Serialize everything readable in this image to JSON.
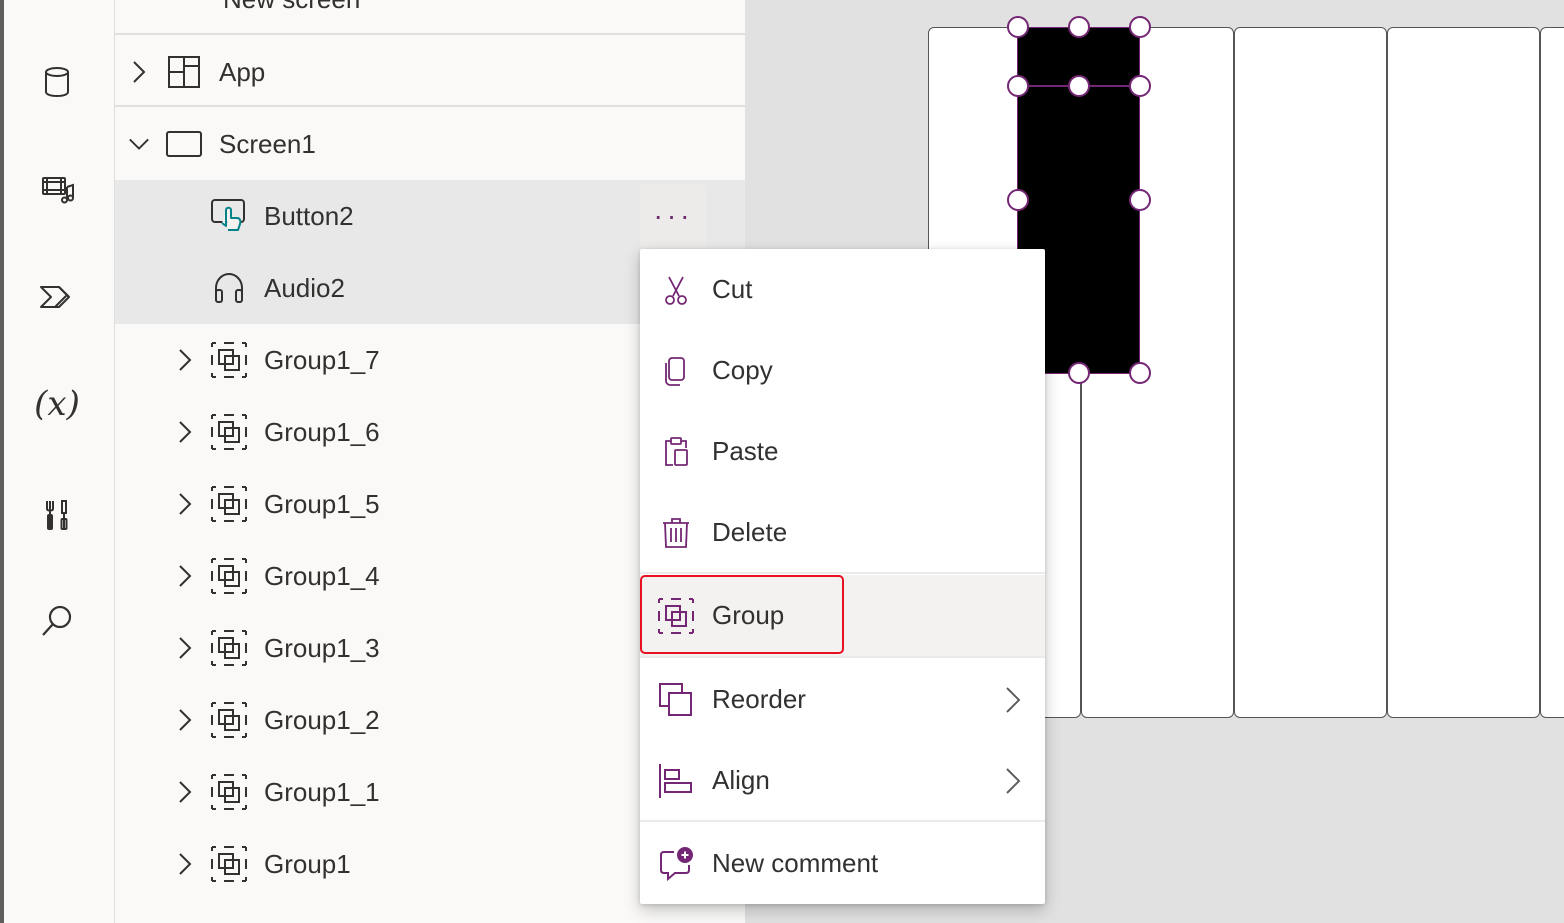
{
  "tree": {
    "partial_top_label": "New screen",
    "rows": [
      {
        "label": "App",
        "icon": "app-grid-icon"
      },
      {
        "label": "Screen1",
        "icon": "screen-icon"
      },
      {
        "label": "Button2",
        "icon": "button-icon"
      },
      {
        "label": "Audio2",
        "icon": "headphones-icon"
      },
      {
        "label": "Group1_7",
        "icon": "group-icon"
      },
      {
        "label": "Group1_6",
        "icon": "group-icon"
      },
      {
        "label": "Group1_5",
        "icon": "group-icon"
      },
      {
        "label": "Group1_4",
        "icon": "group-icon"
      },
      {
        "label": "Group1_3",
        "icon": "group-icon"
      },
      {
        "label": "Group1_2",
        "icon": "group-icon"
      },
      {
        "label": "Group1_1",
        "icon": "group-icon"
      },
      {
        "label": "Group1",
        "icon": "group-icon"
      }
    ],
    "more_label": "···"
  },
  "rail": {
    "items": [
      "database-icon",
      "media-icon",
      "power-automate-icon",
      "variables-icon",
      "tools-icon",
      "search-icon"
    ],
    "variables_label": "(x)"
  },
  "menu": {
    "items": [
      {
        "label": "Cut",
        "icon": "cut-icon"
      },
      {
        "label": "Copy",
        "icon": "copy-icon"
      },
      {
        "label": "Paste",
        "icon": "paste-icon"
      },
      {
        "label": "Delete",
        "icon": "delete-icon"
      },
      {
        "label": "Group",
        "icon": "group-icon"
      },
      {
        "label": "Reorder",
        "icon": "reorder-icon"
      },
      {
        "label": "Align",
        "icon": "align-icon"
      },
      {
        "label": "New comment",
        "icon": "new-comment-icon"
      }
    ]
  },
  "colors": {
    "accent": "#742774",
    "highlight_border": "#e81123",
    "selected_row": "#e8e8e8",
    "canvas_bg": "#e1e1e1"
  }
}
